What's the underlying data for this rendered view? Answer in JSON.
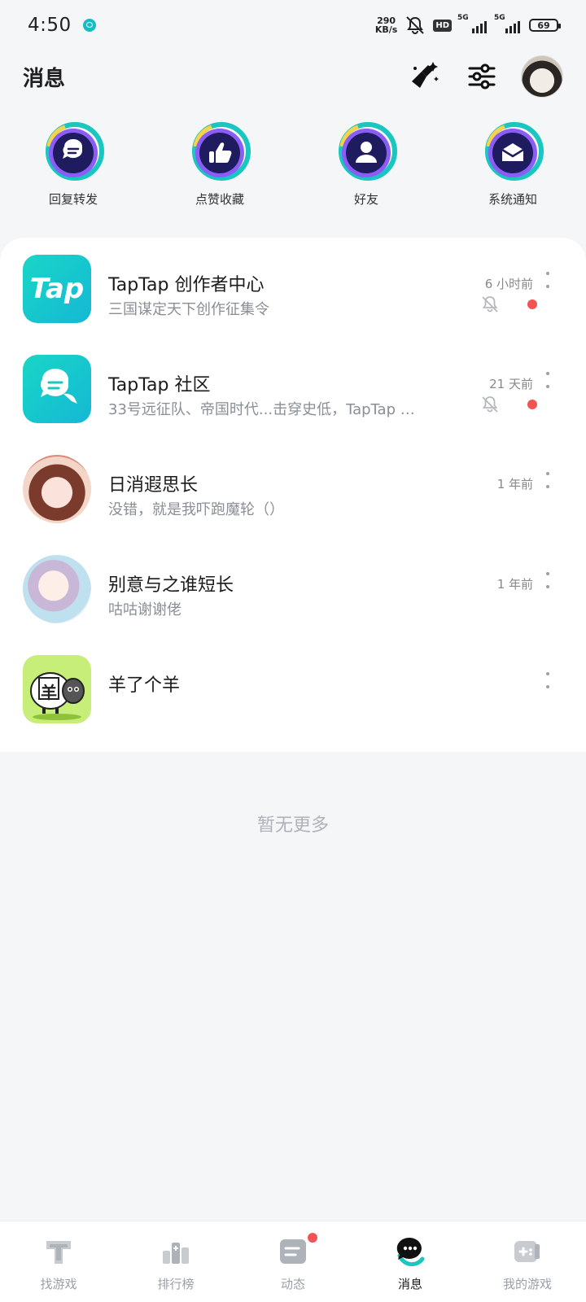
{
  "status_bar": {
    "time": "4:50",
    "net_speed_value": "290",
    "net_speed_unit": "KB/s",
    "hd_label": "HD",
    "signal1_label": "5G",
    "signal2_label": "5G",
    "battery": "69"
  },
  "header": {
    "title": "消息"
  },
  "shortcuts": [
    {
      "label": "回复转发",
      "icon": "chat-bubble-icon"
    },
    {
      "label": "点赞收藏",
      "icon": "thumbs-up-icon"
    },
    {
      "label": "好友",
      "icon": "person-icon"
    },
    {
      "label": "系统通知",
      "icon": "mail-icon"
    }
  ],
  "conversations": [
    {
      "name": "TapTap 创作者中心",
      "preview": "三国谋定天下创作征集令",
      "time": "6 小时前",
      "muted": true,
      "unread": true,
      "avatar_text": "Tap"
    },
    {
      "name": "TapTap 社区",
      "preview": "33号远征队、帝国时代...击穿史低，TapTap …",
      "time": "21 天前",
      "muted": true,
      "unread": true
    },
    {
      "name": "日消遐思长",
      "preview": "没错，就是我吓跑魔轮（）",
      "time": "1 年前",
      "muted": false,
      "unread": false
    },
    {
      "name": "别意与之谁短长",
      "preview": "咕咕谢谢佬",
      "time": "1 年前",
      "muted": false,
      "unread": false
    },
    {
      "name": "羊了个羊",
      "preview": "",
      "time": "",
      "muted": false,
      "unread": false,
      "avatar_text": "羊"
    }
  ],
  "footer_note": "暂无更多",
  "bottom_nav": [
    {
      "label": "找游戏",
      "icon": "find-games-icon",
      "active": false
    },
    {
      "label": "排行榜",
      "icon": "ranking-icon",
      "active": false
    },
    {
      "label": "动态",
      "icon": "feed-icon",
      "active": false,
      "badge": true
    },
    {
      "label": "消息",
      "icon": "messages-icon",
      "active": true
    },
    {
      "label": "我的游戏",
      "icon": "my-games-icon",
      "active": false
    }
  ],
  "colors": {
    "accent": "#19c6c0",
    "badge_red": "#f25454",
    "shortcut_navy": "#1e1b5e",
    "shortcut_purple": "#8b5cf6"
  }
}
